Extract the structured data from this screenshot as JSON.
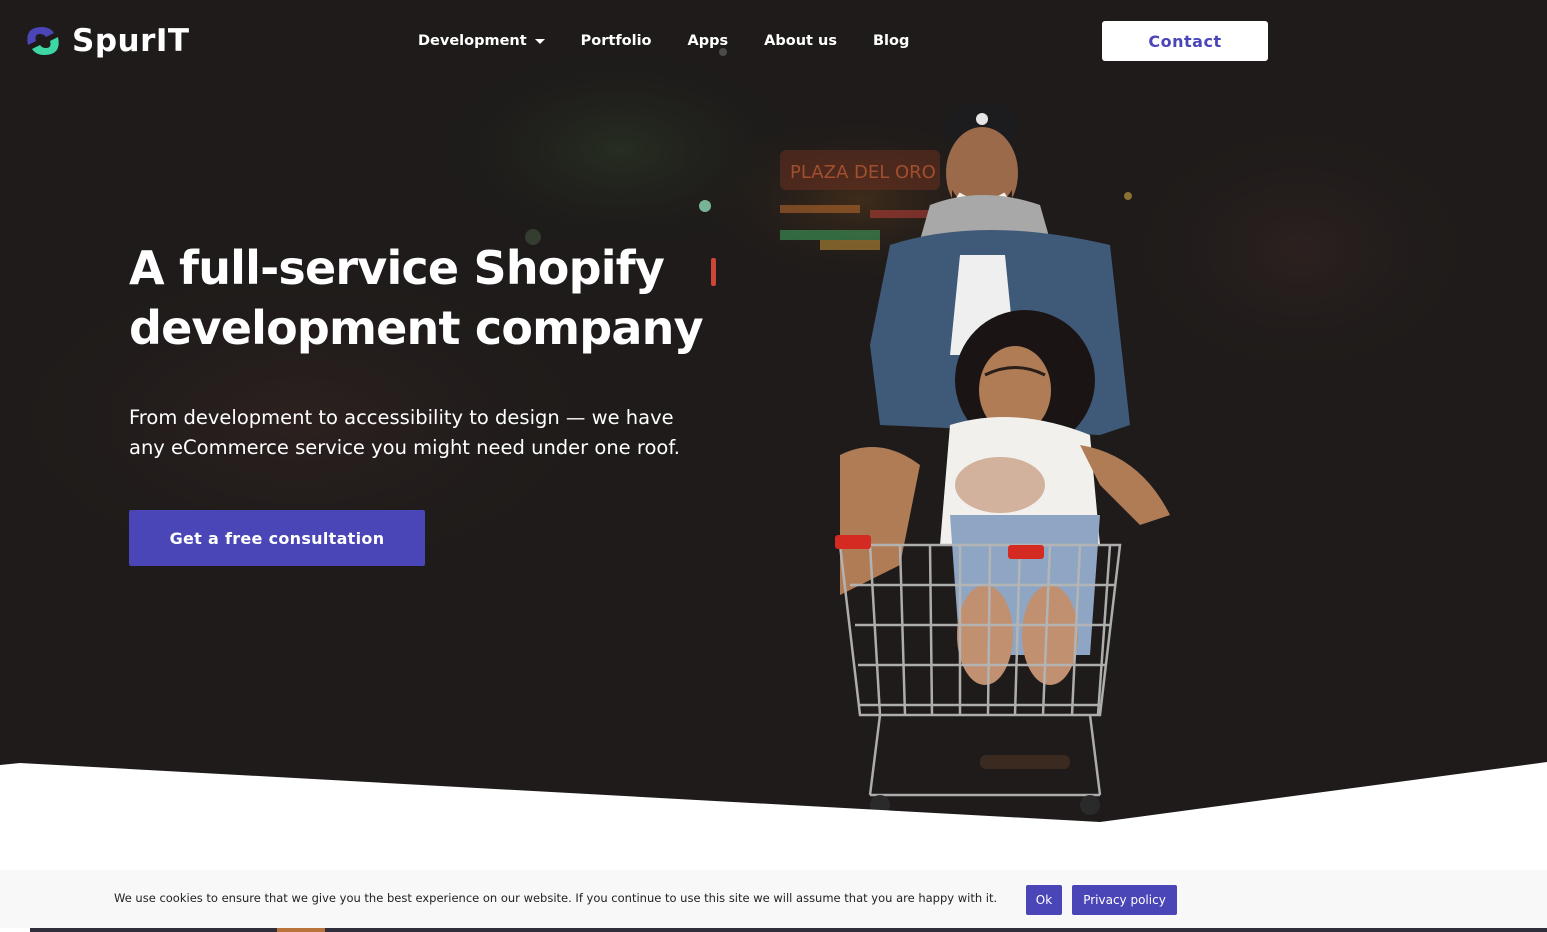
{
  "brand": {
    "name": "SpurIT",
    "accent_color": "#4a46b8",
    "logo_colors": [
      "#4a46b8",
      "#3fd6a5"
    ]
  },
  "nav": {
    "items": [
      {
        "label": "Development",
        "has_dropdown": true
      },
      {
        "label": "Portfolio"
      },
      {
        "label": "Apps"
      },
      {
        "label": "About us"
      },
      {
        "label": "Blog"
      }
    ],
    "contact_label": "Contact"
  },
  "hero": {
    "title_line1": "A full-service Shopify",
    "title_line2": "development company",
    "subtitle_line1": "From development to accessibility to design — we have",
    "subtitle_line2": "any eCommerce service you might need under one roof.",
    "cta_label": "Get a free consultation",
    "image_icon": "hero-photo-people-shopping-cart",
    "background_color": "#1d1a19"
  },
  "cookie": {
    "message": "We use cookies to ensure that we give you the best experience on our website. If you continue to use this site we will assume that you are happy with it.",
    "ok_label": "Ok",
    "privacy_label": "Privacy policy"
  }
}
